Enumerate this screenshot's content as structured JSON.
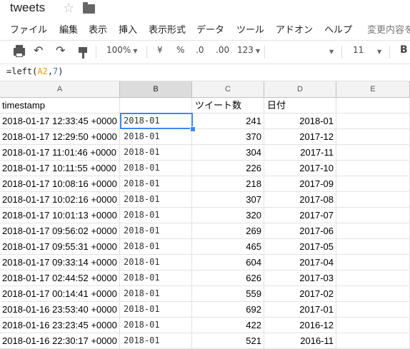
{
  "app": {
    "doc_title": "tweets"
  },
  "menu": {
    "items": [
      "ファイル",
      "編集",
      "表示",
      "挿入",
      "表示形式",
      "データ",
      "ツール",
      "アドオン",
      "ヘルプ"
    ],
    "status": "変更内容を"
  },
  "toolbar": {
    "zoom": "100%",
    "currency": "¥",
    "percent": "%",
    "decrease_decimals": ".0",
    "increase_decimals": ".00",
    "more_formats": "123",
    "font_size": "11",
    "bold": "B"
  },
  "formula_bar": {
    "prefix": "=left(",
    "ref": "A2",
    "comma": ",",
    "num": "7",
    "suffix": ")"
  },
  "columns": [
    "A",
    "B",
    "C",
    "D",
    "E"
  ],
  "selected_column": "B",
  "active_cell": "B2",
  "rows": [
    {
      "A": "timestamp",
      "B": "",
      "C": "ツイート数",
      "D": "日付",
      "E": ""
    },
    {
      "A": "2018-01-17 12:33:45 +0000",
      "B": "2018-01",
      "C": "241",
      "D": "2018-01",
      "E": ""
    },
    {
      "A": "2018-01-17 12:29:50 +0000",
      "B": "2018-01",
      "C": "370",
      "D": "2017-12",
      "E": ""
    },
    {
      "A": "2018-01-17 11:01:46 +0000",
      "B": "2018-01",
      "C": "304",
      "D": "2017-11",
      "E": ""
    },
    {
      "A": "2018-01-17 10:11:55 +0000",
      "B": "2018-01",
      "C": "226",
      "D": "2017-10",
      "E": ""
    },
    {
      "A": "2018-01-17 10:08:16 +0000",
      "B": "2018-01",
      "C": "218",
      "D": "2017-09",
      "E": ""
    },
    {
      "A": "2018-01-17 10:02:16 +0000",
      "B": "2018-01",
      "C": "307",
      "D": "2017-08",
      "E": ""
    },
    {
      "A": "2018-01-17 10:01:13 +0000",
      "B": "2018-01",
      "C": "320",
      "D": "2017-07",
      "E": ""
    },
    {
      "A": "2018-01-17 09:56:02 +0000",
      "B": "2018-01",
      "C": "269",
      "D": "2017-06",
      "E": ""
    },
    {
      "A": "2018-01-17 09:55:31 +0000",
      "B": "2018-01",
      "C": "465",
      "D": "2017-05",
      "E": ""
    },
    {
      "A": "2018-01-17 09:33:14 +0000",
      "B": "2018-01",
      "C": "604",
      "D": "2017-04",
      "E": ""
    },
    {
      "A": "2018-01-17 02:44:52 +0000",
      "B": "2018-01",
      "C": "626",
      "D": "2017-03",
      "E": ""
    },
    {
      "A": "2018-01-17 00:14:41 +0000",
      "B": "2018-01",
      "C": "559",
      "D": "2017-02",
      "E": ""
    },
    {
      "A": "2018-01-16 23:53:40 +0000",
      "B": "2018-01",
      "C": "692",
      "D": "2017-01",
      "E": ""
    },
    {
      "A": "2018-01-16 23:23:45 +0000",
      "B": "2018-01",
      "C": "422",
      "D": "2016-12",
      "E": ""
    },
    {
      "A": "2018-01-16 22:30:17 +0000",
      "B": "2018-01",
      "C": "521",
      "D": "2016-11",
      "E": ""
    }
  ]
}
